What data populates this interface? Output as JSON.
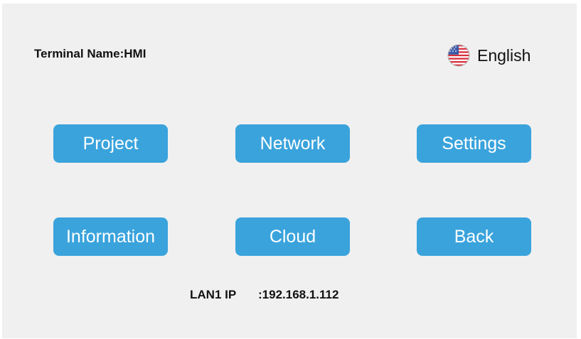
{
  "terminal": {
    "label": "Terminal Name:",
    "value": "HMI"
  },
  "language": {
    "label": "English",
    "icon": "us-flag-icon"
  },
  "buttons": {
    "project": "Project",
    "network": "Network",
    "settings": "Settings",
    "information": "Information",
    "cloud": "Cloud",
    "back": "Back"
  },
  "lan": {
    "label": "LAN1 IP",
    "value": ":192.168.1.112"
  },
  "colors": {
    "button_bg": "#3aa3dc",
    "button_text": "#ffffff",
    "background": "#f0f0f0"
  }
}
